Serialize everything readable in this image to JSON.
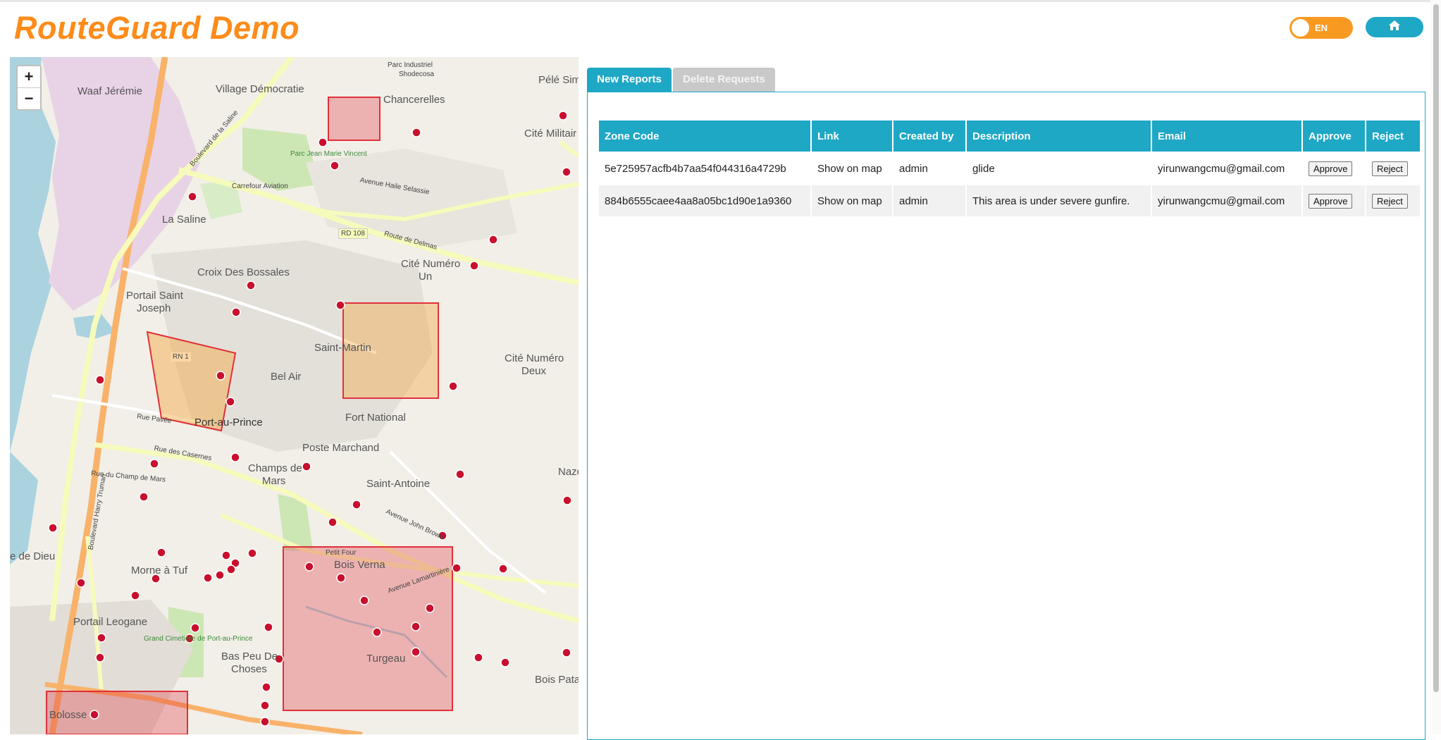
{
  "header": {
    "title": "RouteGuard Demo",
    "lang_label": "EN",
    "home_icon": "home-icon"
  },
  "map": {
    "zoom_in": "+",
    "zoom_out": "−",
    "labels": {
      "waaf_jeremie": "Waaf Jérémie",
      "village_democratie": "Village Démocratie",
      "parc_industriel": "Parc Industriel",
      "shodecosa": "Shodecosa",
      "pele_sim": "Pélé Sim",
      "chancerelles": "Chancerelles",
      "cite_militaire": "Cité Militair",
      "parc_jean_marie_vincent": "Parc Jean Marie Vincent",
      "carrefour_aviation": "Carrefour Aviation",
      "la_saline": "La Saline",
      "croix_des_bossales": "Croix Des Bossales",
      "cite_numero_un": "Cité Numéro",
      "un": "Un",
      "portail_saint_joseph": "Portail Saint",
      "joseph": "Joseph",
      "saint_martin": "Saint-Martin",
      "bel_air": "Bel Air",
      "cite_numero_deux": "Cité Numéro",
      "deux": "Deux",
      "fort_national": "Fort National",
      "port_au_prince": "Port-au-Prince",
      "poste_marchand": "Poste Marchand",
      "champs_de_mars": "Champs de",
      "mars": "Mars",
      "saint_antoine": "Saint-Antoine",
      "nazo": "Nazo",
      "bois_verna": "Bois Verna",
      "petit_four": "Petit Four",
      "morne_a_tuf": "Morne à Tuf",
      "portail_leogane": "Portail Leogane",
      "grand_cimetiere": "Grand Cimetière de Port-au-Prince",
      "bas_peu_de_choses": "Bas Peu De",
      "choses": "Choses",
      "turgeau": "Turgeau",
      "bois_patat": "Bois Pata",
      "bolosse": "Bolosse",
      "rd108": "RD 108",
      "rn1": "RN 1",
      "route_de_delmas": "Route de Delmas",
      "avenue_john_brown": "Avenue John Brown",
      "boulevard_harry_truman": "Boulevard Harry Truman",
      "boulevard_la_saline": "Boulevard de la Saline",
      "avenue_haile_selassie": "Avenue Haile Selassie",
      "rue_des_casernes": "Rue des Casernes",
      "rue_pavee": "Rue Pavée",
      "avenue_lamartiniere": "Avenue Lamartinière",
      "cite_de_dieu": "e de Dieu",
      "rue_du_champ_de_mars": "Rue du Champ de Mars"
    }
  },
  "tabs": [
    {
      "label": "New Reports",
      "active": true
    },
    {
      "label": "Delete Requests",
      "active": false
    }
  ],
  "table": {
    "headers": [
      "Zone Code",
      "Link",
      "Created by",
      "Description",
      "Email",
      "Approve",
      "Reject"
    ],
    "rows": [
      {
        "zone_code": "5e725957acfb4b7aa54f044316a4729b",
        "link": "Show on map",
        "created_by": "admin",
        "description": "glide",
        "email": "yirunwangcmu@gmail.com",
        "approve": "Approve",
        "reject": "Reject"
      },
      {
        "zone_code": "884b6555caee4aa8a05bc1d90e1a9360",
        "link": "Show on map",
        "created_by": "admin",
        "description": "This area is under severe gunfire.",
        "email": "yirunwangcmu@gmail.com",
        "approve": "Approve",
        "reject": "Reject"
      }
    ]
  },
  "colors": {
    "brand_orange": "#ff8c1a",
    "accent_teal": "#1fa8c6",
    "zone_red": "#e0313b",
    "zone_orange": "#f4a63c"
  }
}
